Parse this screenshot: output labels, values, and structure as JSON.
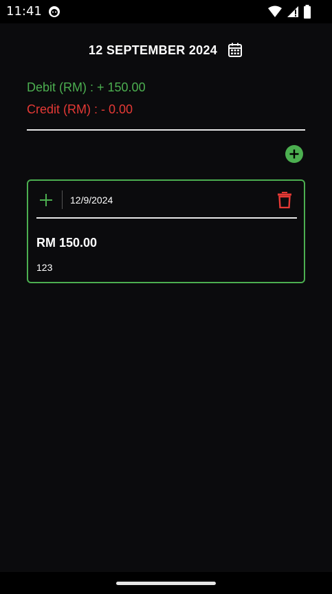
{
  "status_bar": {
    "time": "11:41"
  },
  "header": {
    "date_title": "12 SEPTEMBER 2024"
  },
  "summary": {
    "debit": "Debit (RM) : + 150.00",
    "credit": "Credit (RM) : - 0.00"
  },
  "entries": [
    {
      "date": "12/9/2024",
      "amount": "RM 150.00",
      "note": "123",
      "type": "debit"
    }
  ],
  "colors": {
    "debit": "#4caf50",
    "credit": "#e53935",
    "background": "#0b0b0d"
  },
  "icons": {
    "calendar": "calendar-icon",
    "add": "plus-circle-icon",
    "entry_type": "plus-icon",
    "delete": "trash-icon"
  }
}
